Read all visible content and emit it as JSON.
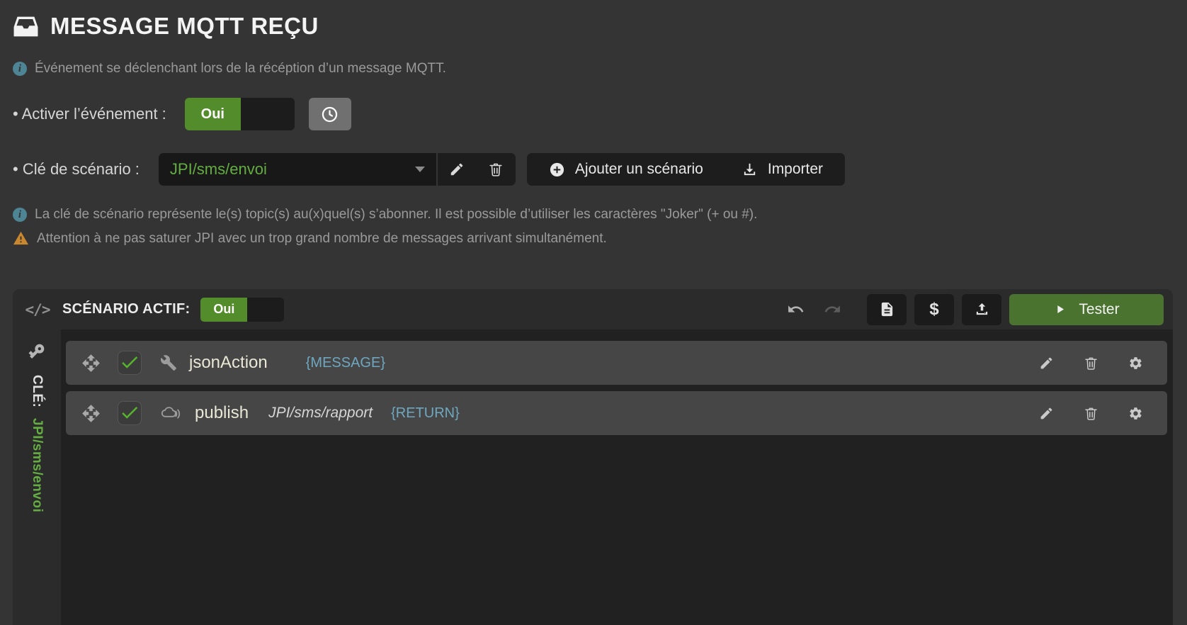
{
  "header": {
    "title": "MESSAGE MQTT REÇU",
    "description": "Événement se déclenchant lors de la récéption d’un message MQTT."
  },
  "enable_event": {
    "label": "• Activer l’événement :",
    "toggle_value": "Oui"
  },
  "scenario_key": {
    "label": "• Clé de scénario :",
    "selected": "JPI/sms/envoi",
    "add_label": "Ajouter un scénario",
    "import_label": "Importer",
    "info": "La clé de scénario représente le(s) topic(s) au(x)quel(s) s’abonner. Il est possible d’utiliser les caractères \"Joker\" (+ ou #).",
    "warning": "Attention à ne pas saturer JPI avec un trop grand nombre de messages arrivant simultanément."
  },
  "panel": {
    "code_glyph": "</>",
    "active_label": "SCÉNARIO ACTIF:",
    "toggle_value": "Oui",
    "dollar_glyph": "$",
    "test_label": "Tester",
    "sidebar_key_label": "CLÉ:",
    "sidebar_key_value": "JPI/sms/envoi",
    "rows": [
      {
        "name": "jsonAction",
        "topic": "",
        "tag": "{MESSAGE}"
      },
      {
        "name": "publish",
        "topic": "JPI/sms/rapport",
        "tag": "{RETURN}"
      }
    ]
  },
  "icons": {
    "title": "inbox-icon",
    "notes": [
      "info-circle-icon",
      "warning-triangle-icon"
    ],
    "enable_row": [
      "clock-icon"
    ],
    "key_row": [
      "caret-down-icon",
      "pencil-icon",
      "trash-icon",
      "plus-circle-icon",
      "download-icon"
    ],
    "panel_header": [
      "code-icon",
      "undo-icon",
      "redo-icon",
      "document-icon",
      "dollar-icon",
      "upload-icon",
      "play-icon"
    ],
    "sidebar": [
      "key-icon"
    ],
    "rows": [
      "move-icon",
      "check-icon",
      "wrench-icon",
      "cloud-publish-icon",
      "pencil-icon",
      "trash-icon",
      "gear-icon"
    ]
  },
  "colors": {
    "page_bg": "#343434",
    "panel_header_bg": "#2b2b2b",
    "panel_content_bg": "#212121",
    "row_bg": "#464646",
    "button_dark_bg": "#1b1b1b",
    "accent_green_text": "#64ad42",
    "toggle_green": "#538c2b",
    "test_button_green": "#4b7330",
    "tag_blue": "#6fa7bf",
    "warning_orange": "#c9872e",
    "info_teal": "#4d8595",
    "check_green": "#56b42c"
  }
}
